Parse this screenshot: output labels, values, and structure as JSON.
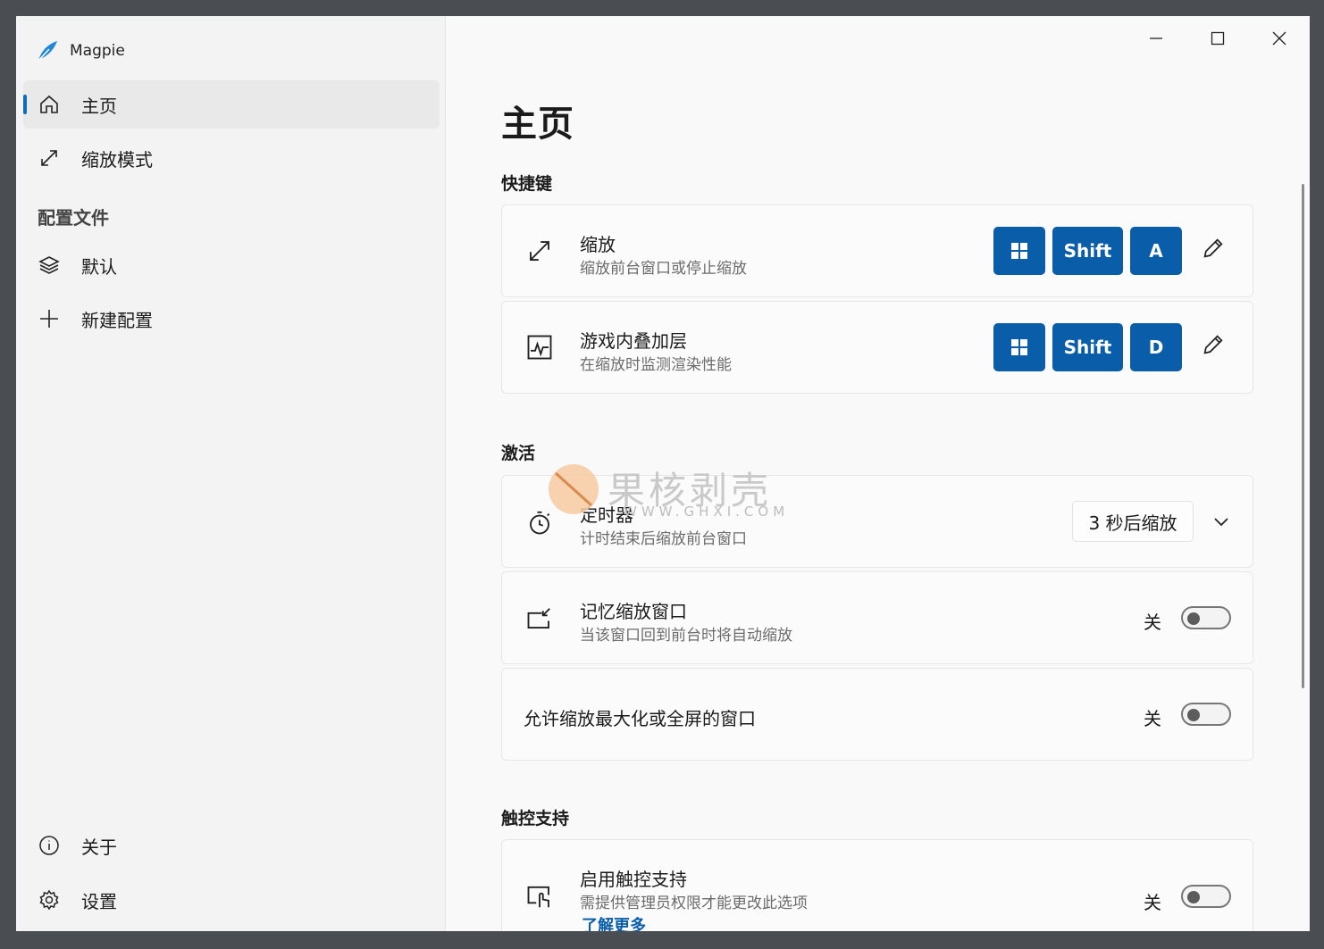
{
  "app": {
    "title": "Magpie"
  },
  "sidebar": {
    "items": [
      {
        "label": "主页",
        "icon": "home-icon"
      },
      {
        "label": "缩放模式",
        "icon": "resize-icon"
      }
    ],
    "section": "配置文件",
    "profiles": [
      {
        "label": "默认",
        "icon": "layers-icon"
      },
      {
        "label": "新建配置",
        "icon": "plus-icon"
      }
    ],
    "footer": [
      {
        "label": "关于",
        "icon": "info-icon"
      },
      {
        "label": "设置",
        "icon": "gear-icon"
      }
    ]
  },
  "main": {
    "title": "主页",
    "shortcuts": {
      "heading": "快捷键",
      "items": [
        {
          "title": "缩放",
          "subtitle": "缩放前台窗口或停止缩放",
          "keys": [
            "Shift",
            "A"
          ]
        },
        {
          "title": "游戏内叠加层",
          "subtitle": "在缩放时监测渲染性能",
          "keys": [
            "Shift",
            "D"
          ]
        }
      ]
    },
    "activation": {
      "heading": "激活",
      "timer": {
        "title": "定时器",
        "subtitle": "计时结束后缩放前台窗口",
        "value": "3 秒后缩放"
      },
      "remember": {
        "title": "记忆缩放窗口",
        "subtitle": "当该窗口回到前台时将自动缩放",
        "state": "关"
      },
      "allow_max": {
        "title": "允许缩放最大化或全屏的窗口",
        "state": "关"
      }
    },
    "touch": {
      "heading": "触控支持",
      "enable": {
        "title": "启用触控支持",
        "subtitle": "需提供管理员权限才能更改此选项",
        "state": "关",
        "link": "了解更多"
      }
    }
  },
  "watermark": {
    "text": "果核剥壳",
    "url": "WWW.GHXI.COM"
  },
  "colors": {
    "accent": "#0a5da8",
    "background": "#f9f9f9",
    "sidebar": "#f3f3f3"
  }
}
